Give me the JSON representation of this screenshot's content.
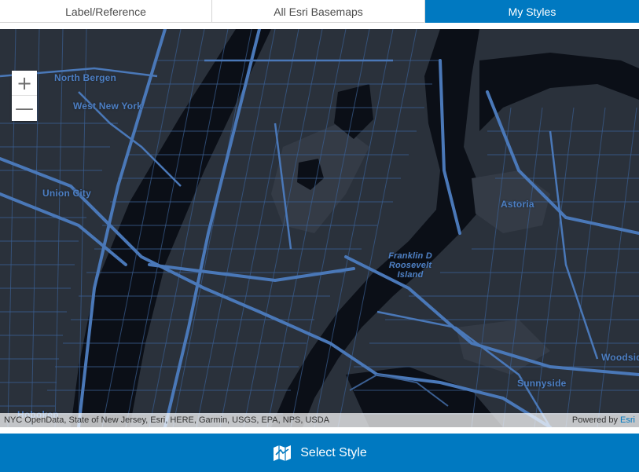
{
  "tabs": [
    {
      "label": "Label/Reference",
      "active": false
    },
    {
      "label": "All Esri Basemaps",
      "active": false
    },
    {
      "label": "My Styles",
      "active": true
    }
  ],
  "map": {
    "zoom_in": "+",
    "zoom_out": "—",
    "labels": {
      "north_bergen": "North Bergen",
      "west_new_york": "West New York",
      "union_city": "Union City",
      "hoboken": "Hoboken",
      "astoria": "Astoria",
      "roosevelt_1": "Franklin D",
      "roosevelt_2": "Roosevelt",
      "roosevelt_3": "Island",
      "sunnyside": "Sunnyside",
      "woodside": "Woodsid"
    },
    "colors": {
      "land": "#2a313b",
      "water": "#0b0f17",
      "roads": "#4a78b8",
      "park": "#343b46"
    }
  },
  "attribution": {
    "sources": "NYC OpenData, State of New Jersey, Esri, HERE, Garmin, USGS, EPA, NPS, USDA",
    "powered_by": "Powered by",
    "esri": "Esri"
  },
  "footer": {
    "label": "Select Style",
    "icon": "map-style-icon"
  }
}
